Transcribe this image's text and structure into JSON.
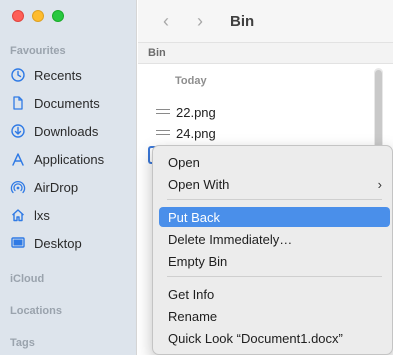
{
  "sidebar": {
    "favourites_label": "Favourites",
    "items": [
      {
        "label": "Recents",
        "icon": "clock-icon"
      },
      {
        "label": "Documents",
        "icon": "document-icon"
      },
      {
        "label": "Downloads",
        "icon": "download-icon"
      },
      {
        "label": "Applications",
        "icon": "applications-icon"
      },
      {
        "label": "AirDrop",
        "icon": "airdrop-icon"
      },
      {
        "label": "lxs",
        "icon": "home-icon"
      },
      {
        "label": "Desktop",
        "icon": "desktop-icon"
      }
    ],
    "icloud_label": "iCloud",
    "locations_label": "Locations",
    "tags_label": "Tags"
  },
  "toolbar": {
    "back_icon": "chevron-left-icon",
    "forward_icon": "chevron-right-icon",
    "title": "Bin"
  },
  "pathbar": {
    "label": "Bin"
  },
  "file_list": {
    "group_header": "Today",
    "files": [
      {
        "name": "22.png"
      },
      {
        "name": "24.png"
      }
    ]
  },
  "context_menu": {
    "items": [
      {
        "label": "Open"
      },
      {
        "label": "Open With",
        "has_submenu": true
      },
      {
        "label": "Put Back",
        "highlighted": true
      },
      {
        "label": "Delete Immediately…"
      },
      {
        "label": "Empty Bin"
      },
      {
        "label": "Get Info"
      },
      {
        "label": "Rename"
      },
      {
        "label": "Quick Look “Document1.docx”"
      }
    ]
  },
  "colors": {
    "accent": "#4a8fea",
    "sidebar_bg": "#dde4ec",
    "sidebar_icon": "#2f7ae5"
  }
}
